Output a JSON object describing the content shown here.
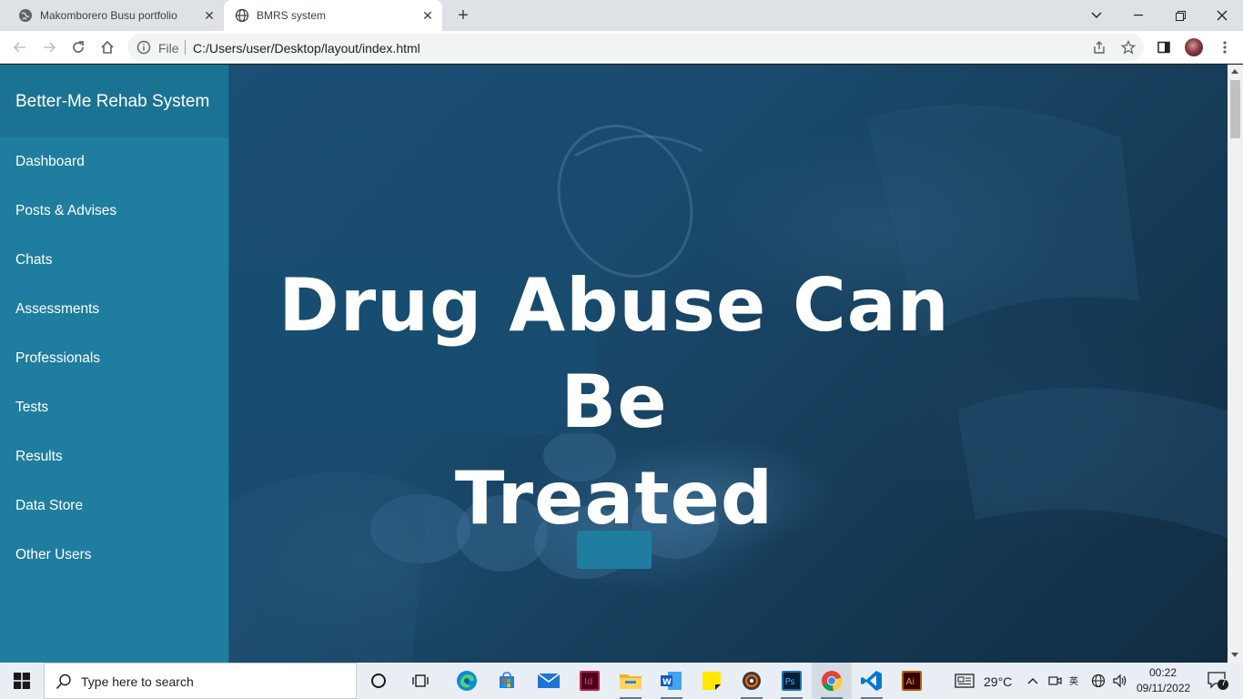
{
  "browser": {
    "tabs": [
      {
        "title": "Makomborero Busu portfolio",
        "active": false
      },
      {
        "title": "BMRS system",
        "active": true
      }
    ],
    "address": {
      "scheme_label": "File",
      "url": "C:/Users/user/Desktop/layout/index.html"
    },
    "window_controls": [
      "chevron-down-icon",
      "minimize-icon",
      "restore-icon",
      "close-icon"
    ]
  },
  "sidebar": {
    "brand": "Better-Me Rehab System",
    "items": [
      {
        "label": "Dashboard"
      },
      {
        "label": "Posts & Advises"
      },
      {
        "label": "Chats"
      },
      {
        "label": "Assessments"
      },
      {
        "label": "Professionals"
      },
      {
        "label": "Tests"
      },
      {
        "label": "Results"
      },
      {
        "label": "Data Store"
      },
      {
        "label": "Other Users"
      }
    ]
  },
  "hero": {
    "title_line1": "Drug Abuse Can Be",
    "title_line2": "Treated",
    "button_label": ""
  },
  "taskbar": {
    "search_placeholder": "Type here to search",
    "apps": [
      "cortana-icon",
      "task-view-icon",
      "edge-icon",
      "store-icon",
      "mail-icon",
      "indesign-icon",
      "file-explorer-icon",
      "word-icon",
      "sticky-notes-icon",
      "media-player-icon",
      "photoshop-icon",
      "chrome-icon",
      "vscode-icon",
      "illustrator-icon"
    ],
    "weather": "29°C",
    "time": "00:22",
    "date": "09/11/2022",
    "notifications": "7"
  },
  "colors": {
    "sidebar": "#1f7da0",
    "brand_bar": "#1b7394",
    "hero_dark": "#163c58",
    "button": "#1f7da0"
  }
}
